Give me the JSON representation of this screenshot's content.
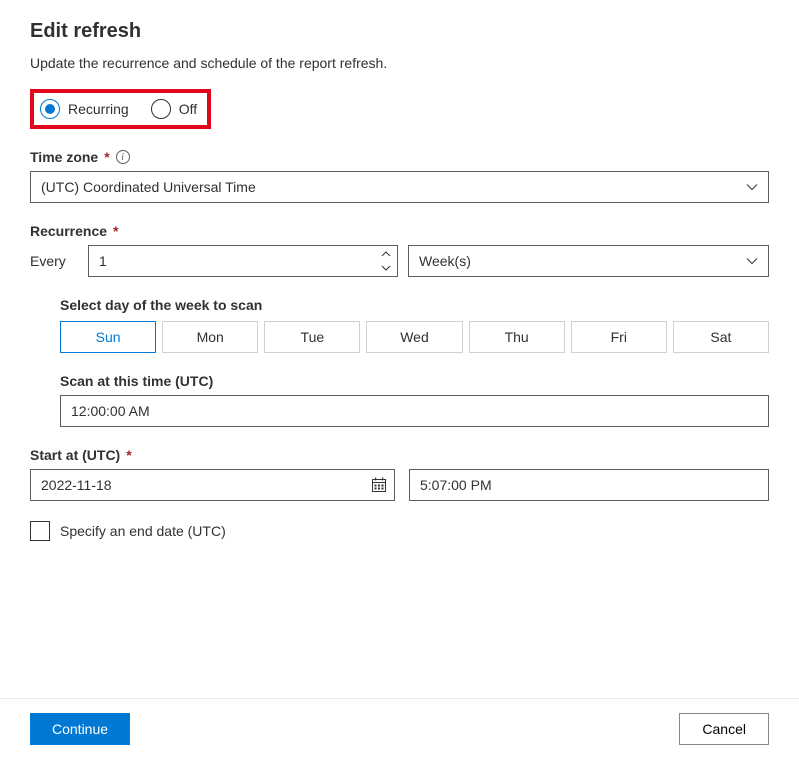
{
  "header": {
    "title": "Edit refresh",
    "subtitle": "Update the recurrence and schedule of the report refresh."
  },
  "radios": {
    "recurring": "Recurring",
    "off": "Off",
    "selected": "recurring"
  },
  "timezone": {
    "label": "Time zone",
    "value": "(UTC) Coordinated Universal Time"
  },
  "recurrence": {
    "label": "Recurrence",
    "every_label": "Every",
    "every_value": "1",
    "unit_value": "Week(s)"
  },
  "days": {
    "label": "Select day of the week to scan",
    "items": [
      "Sun",
      "Mon",
      "Tue",
      "Wed",
      "Thu",
      "Fri",
      "Sat"
    ],
    "selected": "Sun"
  },
  "scan_time": {
    "label": "Scan at this time (UTC)",
    "value": "12:00:00 AM"
  },
  "start_at": {
    "label": "Start at (UTC)",
    "date_value": "2022-11-18",
    "time_value": "5:07:00 PM"
  },
  "end_date": {
    "label": "Specify an end date (UTC)"
  },
  "footer": {
    "continue": "Continue",
    "cancel": "Cancel"
  }
}
